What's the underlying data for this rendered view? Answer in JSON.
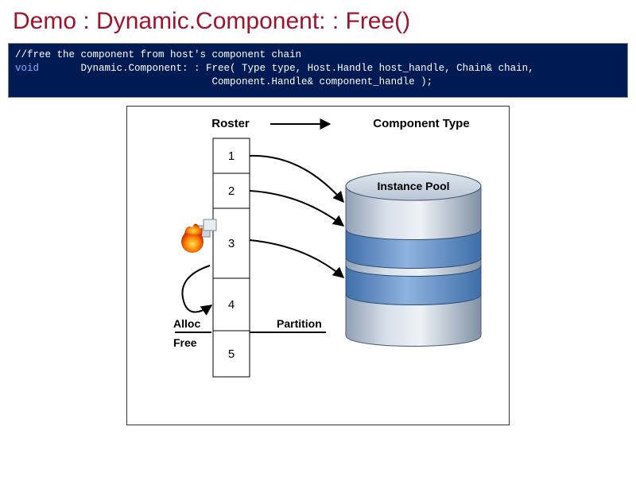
{
  "title": "Demo : Dynamic.Component: : Free()",
  "code": {
    "comment": "//free the component from host's component chain",
    "kw": "void",
    "sig1": "       Dynamic.Component: : Free( Type type, Host.Handle host_handle, Chain& chain,",
    "sig2": "                                 Component.Handle& component_handle );"
  },
  "labels": {
    "roster": "Roster",
    "componentType": "Component Type",
    "instancePool": "Instance Pool",
    "partition": "Partition",
    "alloc": "Alloc",
    "free": "Free"
  },
  "roster_cells": [
    "1",
    "2",
    "3",
    "4",
    "5"
  ]
}
